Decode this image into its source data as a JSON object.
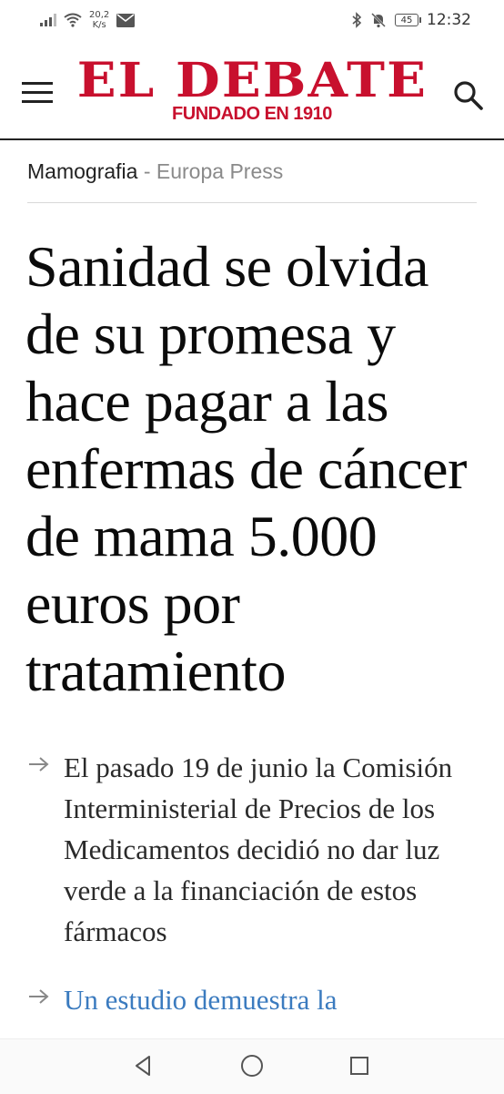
{
  "status_bar": {
    "speed_value": "20,2",
    "speed_unit": "K/s",
    "battery": "45",
    "time": "12:32"
  },
  "header": {
    "logo_title": "EL DEBATE",
    "logo_subtitle": "FUNDADO EN 1910",
    "brand_color": "#c8102e"
  },
  "image_caption": {
    "title": "Mamografia",
    "separator": " - ",
    "credit": "Europa Press"
  },
  "article": {
    "headline": "Sanidad se olvida de su promesa y hace pagar a las enfermas de cáncer de mama 5.000 euros por tratamiento",
    "bullets": [
      {
        "text": "El pasado 19 de junio la Comisión Interministerial de Precios de los Medicamentos decidió no dar luz verde a la financiación de estos fármacos"
      },
      {
        "text": "Un estudio demuestra la"
      }
    ],
    "link_color": "#3b7bbf"
  },
  "icons": {
    "menu": "hamburger-menu-icon",
    "search": "search-icon",
    "bullet_arrow": "arrow-right-icon",
    "nav_back": "back-triangle-icon",
    "nav_home": "home-circle-icon",
    "nav_recents": "recents-square-icon"
  }
}
